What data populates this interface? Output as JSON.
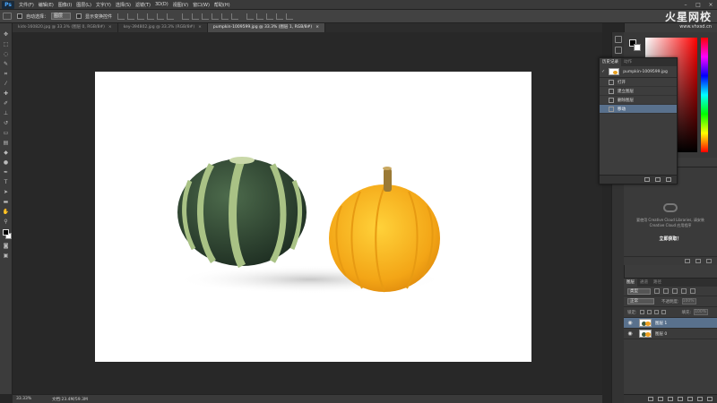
{
  "app": {
    "logo": "Ps"
  },
  "menu": [
    "文件(F)",
    "编辑(E)",
    "图像(I)",
    "图层(L)",
    "文字(Y)",
    "选择(S)",
    "滤镜(T)",
    "3D(D)",
    "视图(V)",
    "窗口(W)",
    "帮助(H)"
  ],
  "options_bar": {
    "auto_select_label": "自动选择：",
    "auto_select_value": "图层",
    "show_transform_label": "显示变换控件"
  },
  "tabs": [
    {
      "label": "kids-160820.jpg @ 33.3% (图层 0, RGB/8#)",
      "active": false
    },
    {
      "label": "key-394802.jpg @ 33.3% (RGB/8#)",
      "active": false
    },
    {
      "label": "pumpkin-1009599.jpg @ 33.3% (图层 1, RGB/8#)",
      "active": true
    }
  ],
  "status": {
    "zoom": "33.33%",
    "doc": "文档:23.4M/59.3M"
  },
  "watermark": {
    "brand": "火星网校",
    "url": "www.vhxsd.cn"
  },
  "history": {
    "tabs": [
      "历史记录",
      "动作"
    ],
    "snapshot": "pumpkin-1009599.jpg",
    "steps": [
      {
        "label": "打开",
        "active": false
      },
      {
        "label": "建立图层",
        "active": false
      },
      {
        "label": "删除图层",
        "active": false
      },
      {
        "label": "移动",
        "active": true
      }
    ]
  },
  "libraries": {
    "message": "要使用 Creative Cloud Libraries, 请安装 Creative Cloud 应用程序",
    "link": "立即获取！"
  },
  "layers_panel": {
    "tabs": [
      "图层",
      "通道",
      "路径"
    ],
    "filter": "类型",
    "blend_mode": "正常",
    "opacity_label": "不透明度:",
    "opacity_value": "100%",
    "lock_label": "锁定:",
    "fill_label": "填充:",
    "fill_value": "100%",
    "layers": [
      {
        "name": "图层 1",
        "active": true
      },
      {
        "name": "图层 0",
        "active": false
      }
    ]
  },
  "colors": {
    "accent": "#59718d",
    "canvas": "#ffffff",
    "workspace": "#282828"
  }
}
